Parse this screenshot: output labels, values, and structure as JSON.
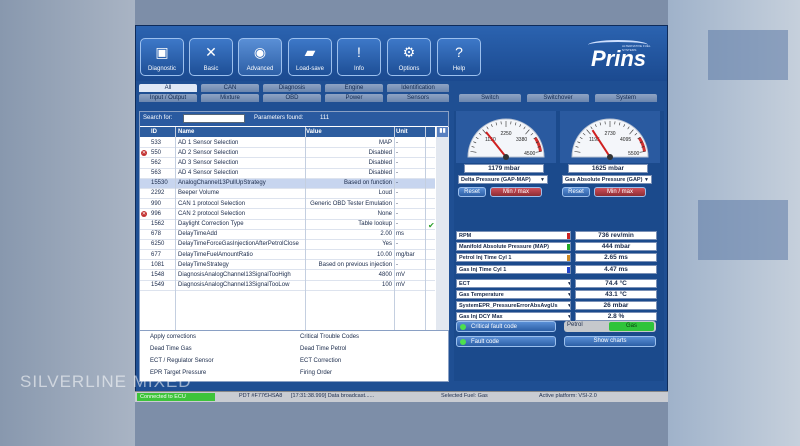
{
  "toolbar": {
    "buttons": [
      {
        "label": "Diagnostic",
        "icon": "monitor-icon"
      },
      {
        "label": "Basic",
        "icon": "tools-icon"
      },
      {
        "label": "Advanced",
        "icon": "gauge-chip-icon"
      },
      {
        "label": "Load-save",
        "icon": "car-icon"
      },
      {
        "label": "Info",
        "icon": "exclamation-icon"
      },
      {
        "label": "Options",
        "icon": "car-wrench-icon"
      },
      {
        "label": "Help",
        "icon": "question-icon"
      }
    ],
    "brand": "Prins",
    "brand_sub": "ALTERNATIVE FUEL SYSTEMS"
  },
  "tabs_row1": [
    "All",
    "CAN",
    "Diagnosis",
    "Engine",
    "Identification"
  ],
  "tabs_row2": [
    "Input / Output",
    "Mixture",
    "OBD",
    "Power",
    "Sensors",
    "Switch",
    "Switchover",
    "System"
  ],
  "search": {
    "label": "Search for:",
    "value": "",
    "found_label": "Parameters found:",
    "found_count": "111"
  },
  "table": {
    "headers": {
      "id": "ID",
      "name": "Name",
      "value": "Value",
      "unit": "Unit"
    },
    "rows": [
      {
        "id": "533",
        "name": "AD 1 Sensor Selection",
        "value": "MAP",
        "unit": "-",
        "err": false,
        "ok": false,
        "hl": false
      },
      {
        "id": "550",
        "name": "AD 2 Sensor Selection",
        "value": "Disabled",
        "unit": "-",
        "err": true,
        "ok": false,
        "hl": false
      },
      {
        "id": "562",
        "name": "AD 3 Sensor Selection",
        "value": "Disabled",
        "unit": "-",
        "err": false,
        "ok": false,
        "hl": false
      },
      {
        "id": "563",
        "name": "AD 4 Sensor Selection",
        "value": "Disabled",
        "unit": "-",
        "err": false,
        "ok": false,
        "hl": false
      },
      {
        "id": "15530",
        "name": "AnalogChannel13PullUpStrategy",
        "value": "Based on function",
        "unit": "-",
        "err": false,
        "ok": false,
        "hl": true
      },
      {
        "id": "2292",
        "name": "Beeper Volume",
        "value": "Loud",
        "unit": "-",
        "err": false,
        "ok": false,
        "hl": false
      },
      {
        "id": "990",
        "name": "CAN 1 protocol Selection",
        "value": "Generic OBD Tester Emulation",
        "unit": "-",
        "err": false,
        "ok": false,
        "hl": false
      },
      {
        "id": "996",
        "name": "CAN 2 protocol Selection",
        "value": "None",
        "unit": "-",
        "err": true,
        "ok": false,
        "hl": false
      },
      {
        "id": "1562",
        "name": "Daylight Correction Type",
        "value": "Table lookup",
        "unit": "-",
        "err": false,
        "ok": true,
        "hl": false
      },
      {
        "id": "678",
        "name": "DelayTimeAdd",
        "value": "2.00",
        "unit": "ms",
        "err": false,
        "ok": false,
        "hl": false
      },
      {
        "id": "6250",
        "name": "DelayTimeForceGasInjectionAfterPetrolClose",
        "value": "Yes",
        "unit": "-",
        "err": false,
        "ok": false,
        "hl": false
      },
      {
        "id": "677",
        "name": "DelayTimeFuelAmountRatio",
        "value": "10.00",
        "unit": "mg/bar",
        "err": false,
        "ok": false,
        "hl": false
      },
      {
        "id": "1081",
        "name": "DelayTimeStrategy",
        "value": "Based on previous injection",
        "unit": "-",
        "err": false,
        "ok": false,
        "hl": false
      },
      {
        "id": "1548",
        "name": "DiagnosisAnalogChannel13SignalTooHigh",
        "value": "4800",
        "unit": "mV",
        "err": false,
        "ok": false,
        "hl": false
      },
      {
        "id": "1549",
        "name": "DiagnosisAnalogChannel13SignalTooLow",
        "value": "100",
        "unit": "mV",
        "err": false,
        "ok": false,
        "hl": false
      }
    ]
  },
  "corrections": [
    "Apply corrections",
    "Critical Trouble Codes",
    "Dead Time Gas",
    "Dead Time Petrol",
    "ECT / Regulator Sensor",
    "ECT Correction",
    "EPR Target Pressure",
    "Firing Order"
  ],
  "gauges": [
    {
      "value": 1179,
      "readout": "1179 mbar",
      "ticks": [
        "1150",
        "2250",
        "3380",
        "4500"
      ],
      "max": 4500,
      "select": "Delta Pressure (GAP-MAP)",
      "reset": "Reset",
      "minmax": "Min / max"
    },
    {
      "value": 1625,
      "readout": "1625 mbar",
      "ticks": [
        "1195",
        "2730",
        "4095",
        "5500"
      ],
      "max": 5500,
      "select": "Gas Absolute Pressure (GAP)",
      "reset": "Reset",
      "minmax": "Min / max"
    }
  ],
  "live_params": [
    {
      "name": "RPM",
      "value": "736 rev/min",
      "color": "#cc2222"
    },
    {
      "name": "Manifold Absolute Pressure (MAP)",
      "value": "444 mbar",
      "color": "#22aa22"
    },
    {
      "name": "Petrol Inj Time Cyl 1",
      "value": "2.65 ms",
      "color": "#cc8822"
    },
    {
      "name": "Gas Inj Time Cyl 1",
      "value": "4.47 ms",
      "color": "#2244cc"
    },
    {
      "name": "ECT",
      "value": "74.4 °C",
      "color": ""
    },
    {
      "name": "Gas Temperature",
      "value": "43.1 °C",
      "color": ""
    },
    {
      "name": "SystemEPR_PressureErrorAbsAvgUs",
      "value": "26 mbar",
      "color": ""
    },
    {
      "name": "Gas Inj DCY Max",
      "value": "2.8 %",
      "color": ""
    }
  ],
  "faults": {
    "critical": "Critical fault code",
    "fault": "Fault code"
  },
  "fuel": {
    "petrol": "Petrol",
    "gas": "Gas"
  },
  "show_charts": "Show charts",
  "status": {
    "connection": "Connected to ECU",
    "pdt": "PDT #F77ЄHSA8",
    "log": "[17:31:38.999] Data broadcast......",
    "fuel": "Selected Fuel: Gas",
    "platform": "Active platform: VSI-2.0"
  },
  "watermark": "SILVERLINE MIXED"
}
